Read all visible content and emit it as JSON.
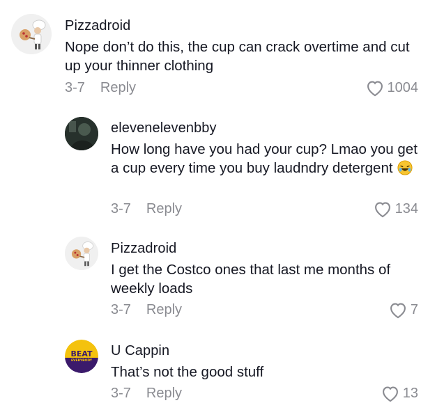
{
  "comments": [
    {
      "username": "Pizzadroid",
      "text": "Nope don’t do this, the cup can crack overtime and cut up your thinner clothing",
      "date": "3-7",
      "reply_label": "Reply",
      "likes": "1004",
      "avatar": "pizza-chef-avatar"
    },
    {
      "username": "elevenelevenbby",
      "text": "How long have you had your cup? Lmao you get a cup every time you buy laudndry detergent",
      "date": "3-7",
      "reply_label": "Reply",
      "likes": "134",
      "avatar": "dark-photo-avatar"
    },
    {
      "username": "Pizzadroid",
      "text": "I get the Costco ones that last me months of weekly loads",
      "date": "3-7",
      "reply_label": "Reply",
      "likes": "7",
      "avatar": "pizza-chef-avatar"
    },
    {
      "username": "U Cappin",
      "text": "That’s not the good stuff",
      "date": "3-7",
      "reply_label": "Reply",
      "likes": "13",
      "avatar": "beat-everybody-avatar",
      "avatar_text": [
        "BEAT",
        "EVERYBODY"
      ]
    }
  ],
  "colors": {
    "text": "#161823",
    "meta": "#8a8b91",
    "beat_yellow": "#f4c20d",
    "beat_purple": "#3b1a6b"
  }
}
